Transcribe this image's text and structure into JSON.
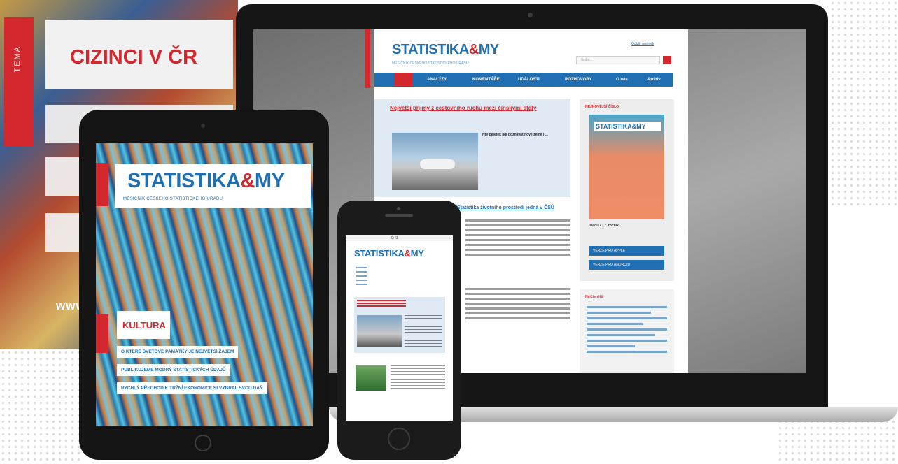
{
  "magazine_back": {
    "tema_label": "TÉMA",
    "title": "CIZINCI V ČR",
    "url": "www."
  },
  "laptop_site": {
    "logo_main": "STATISTIKA",
    "logo_amp": "&",
    "logo_end": "MY",
    "subtitle": "MĚSÍČNÍK ČESKÉHO STATISTICKÉHO ÚŘADU",
    "toplink": "Odběr novinek",
    "search_placeholder": "Hledat...",
    "nav": [
      "ANALÝZY",
      "KOMENTÁŘE",
      "UDÁLOSTI",
      "ROZHOVORY",
      "O nás",
      "Archiv"
    ],
    "headline": "Největší příjmy z cestovního ruchu mezi čínskými státy",
    "main_text": "Hry peleték lidí poznávat nové země i ...",
    "section_title": "Statistika životního prostředí jedná v ČSÚ",
    "side_label": "NEJNOVĚJŠÍ ČÍSLO",
    "side_cover_logo": "STATISTIKA&MY",
    "issue": "08/2017 | 7. ročník",
    "btn_apple": "VERZE PRO APPLE",
    "btn_android": "VERZE PRO ANDROID",
    "side2_label": "Nejčtenější"
  },
  "tablet": {
    "logo_main": "STATISTIKA",
    "logo_amp": "&",
    "logo_end": "MY",
    "subtitle": "MĚSÍČNÍK ČESKÉHO STATISTICKÉHO ÚŘADU",
    "section": "KULTURA",
    "headlines": [
      "O KTERÉ SVĚTOVÉ PAMÁTKY JE NEJVĚTŠÍ ZÁJEM",
      "PUBLIKUJEME MODRÝ STATISTICKÝCH ÚDAJŮ",
      "RYCHLÝ PŘECHOD K TRŽNÍ EKONOMICE SI VYBRAL SVOU DAŇ"
    ]
  },
  "phone": {
    "status_time": "9:41",
    "logo_main": "STATISTIKA",
    "logo_amp": "&",
    "logo_end": "MY"
  }
}
